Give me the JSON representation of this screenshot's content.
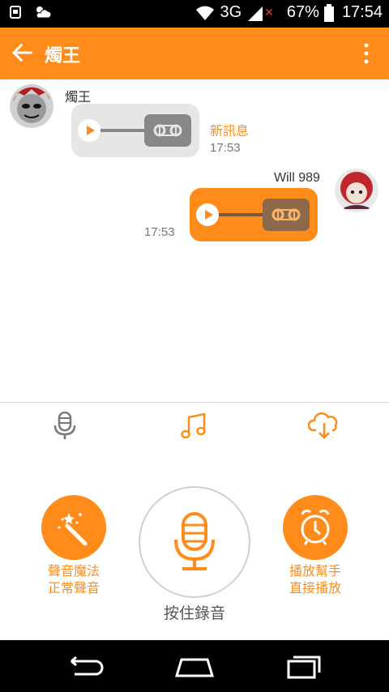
{
  "status_bar": {
    "network": "3G",
    "battery": "67%",
    "time": "17:54",
    "icons": [
      "usb-icon",
      "weather-icon",
      "wifi-icon",
      "signal-icon",
      "battery-icon"
    ]
  },
  "app_bar": {
    "title": "燭王",
    "icons": [
      "back-arrow-icon",
      "more-vert-icon"
    ]
  },
  "messages": [
    {
      "direction": "incoming",
      "sender": "燭王",
      "type": "voice",
      "status": "新訊息",
      "time": "17:53"
    },
    {
      "direction": "outgoing",
      "sender": "Will 989",
      "type": "voice",
      "time": "17:53"
    }
  ],
  "tools": [
    {
      "icon": "microphone-icon",
      "active": false
    },
    {
      "icon": "music-note-icon",
      "active": true
    },
    {
      "icon": "cloud-download-icon",
      "active": true
    }
  ],
  "controls": {
    "left": {
      "icon": "magic-wand-icon",
      "line1": "聲音魔法",
      "line2": "正常聲音"
    },
    "record": {
      "icon": "microphone-icon",
      "label": "按住錄音"
    },
    "right": {
      "icon": "alarm-clock-icon",
      "line1": "播放幫手",
      "line2": "直接播放"
    }
  },
  "nav_bar": {
    "icons": [
      "back-icon",
      "home-icon",
      "recents-icon"
    ]
  },
  "colors": {
    "accent": "#ff8c1a",
    "bubble_in": "#e6e6e6",
    "status_bar": "#000000"
  }
}
